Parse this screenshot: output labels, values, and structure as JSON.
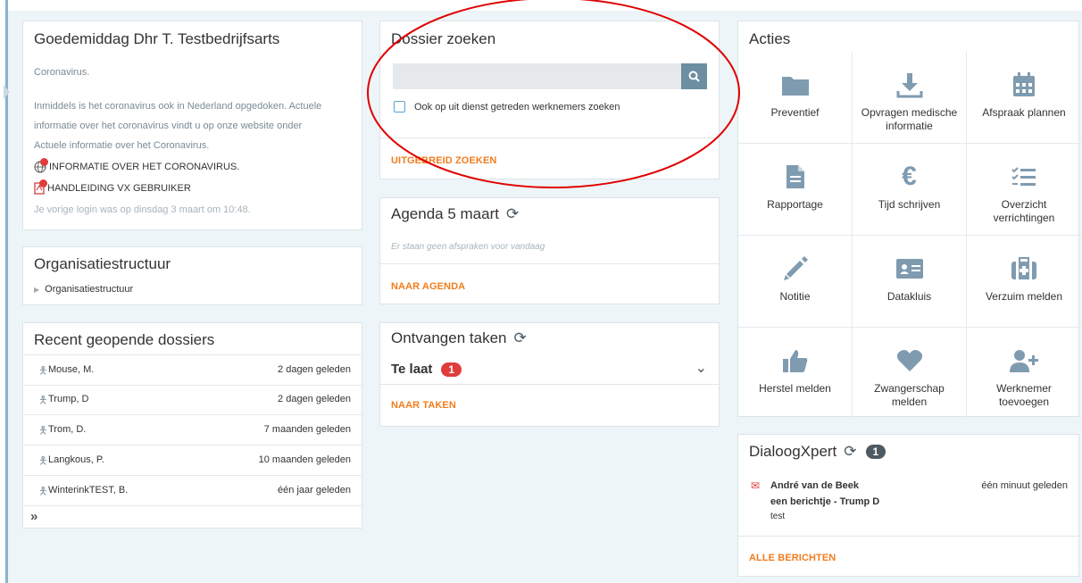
{
  "welcome": {
    "title": "Goedemiddag Dhr T. Testbedrijfsarts",
    "subject": "Coronavirus.",
    "body": "Inmiddels is het coronavirus ook in Nederland opgedoken. Actuele informatie over het coronavirus vindt u op onze website onder Actuele informatie over het Coronavirus.",
    "link1": "INFORMATIE OVER HET CORONAVIRUS.",
    "link2": "HANDLEIDING VX GEBRUIKER",
    "last_login": "Je vorige login was op dinsdag 3 maart om 10:48."
  },
  "org": {
    "title": "Organisatiestructuur",
    "item": "Organisatiestructuur"
  },
  "recent": {
    "title": "Recent geopende dossiers",
    "items": [
      {
        "name": "Mouse, M.",
        "time": "2 dagen geleden"
      },
      {
        "name": "Trump, D",
        "time": "2 dagen geleden"
      },
      {
        "name": "Trom, D.",
        "time": "7 maanden geleden"
      },
      {
        "name": "Langkous, P.",
        "time": "10 maanden geleden"
      },
      {
        "name": "WinterinkTEST, B.",
        "time": "één jaar geleden"
      }
    ],
    "more": "»"
  },
  "search": {
    "title": "Dossier zoeken",
    "placeholder": "",
    "checkbox_label": "Ook op uit dienst getreden werknemers zoeken",
    "advanced": "UITGEBREID ZOEKEN"
  },
  "agenda": {
    "title": "Agenda 5 maart",
    "empty": "Er staan geen afspraken voor vandaag",
    "link": "NAAR AGENDA"
  },
  "tasks": {
    "title": "Ontvangen taken",
    "late_label": "Te laat",
    "late_count": "1",
    "link": "NAAR TAKEN"
  },
  "actions": {
    "title": "Acties",
    "tiles": [
      {
        "label": "Preventief",
        "icon": "folder-icon"
      },
      {
        "label": "Opvragen medische informatie",
        "icon": "download-icon"
      },
      {
        "label": "Afspraak plannen",
        "icon": "calendar-icon"
      },
      {
        "label": "Rapportage",
        "icon": "document-icon"
      },
      {
        "label": "Tijd schrijven",
        "icon": "euro-icon"
      },
      {
        "label": "Overzicht verrichtingen",
        "icon": "checklist-icon"
      },
      {
        "label": "Notitie",
        "icon": "pencil-icon"
      },
      {
        "label": "Datakluis",
        "icon": "id-card-icon"
      },
      {
        "label": "Verzuim melden",
        "icon": "medical-case-icon"
      },
      {
        "label": "Herstel melden",
        "icon": "thumbs-up-icon"
      },
      {
        "label": "Zwangerschap melden",
        "icon": "heart-icon"
      },
      {
        "label": "Werknemer toevoegen",
        "icon": "add-user-icon"
      }
    ]
  },
  "dialoog": {
    "title": "DialoogXpert",
    "count": "1",
    "sender": "André van de Beek",
    "time": "één minuut geleden",
    "subject": "een berichtje - Trump D",
    "preview": "test",
    "link": "ALLE BERICHTEN"
  },
  "colors": {
    "accent": "#f07d1e",
    "search_button": "#6d8ea2",
    "badge": "#e03c3c",
    "annotation": "#e00000"
  }
}
